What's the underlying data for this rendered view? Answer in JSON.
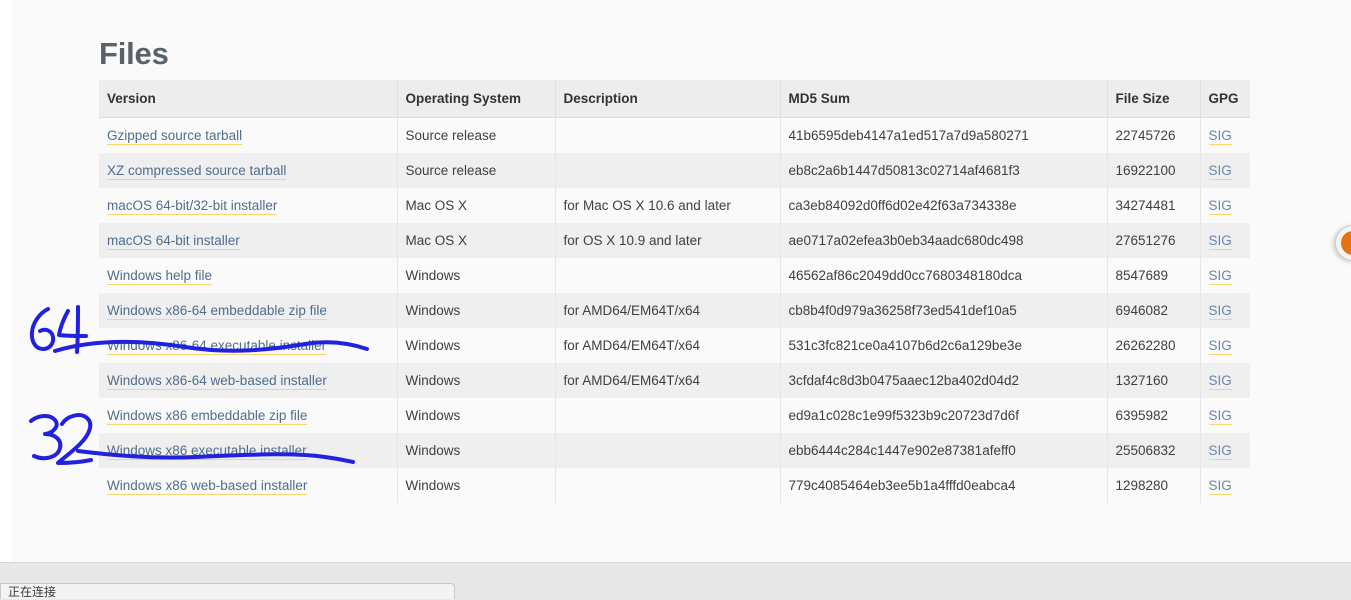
{
  "page": {
    "title": "Files"
  },
  "table": {
    "columns": [
      "Version",
      "Operating System",
      "Description",
      "MD5 Sum",
      "File Size",
      "GPG"
    ],
    "gpg_label": "SIG",
    "rows": [
      {
        "version": "Gzipped source tarball",
        "os": "Source release",
        "description": "",
        "md5": "41b6595deb4147a1ed517a7d9a580271",
        "size": "22745726",
        "gpg": "SIG"
      },
      {
        "version": "XZ compressed source tarball",
        "os": "Source release",
        "description": "",
        "md5": "eb8c2a6b1447d50813c02714af4681f3",
        "size": "16922100",
        "gpg": "SIG"
      },
      {
        "version": "macOS 64-bit/32-bit installer",
        "os": "Mac OS X",
        "description": "for Mac OS X 10.6 and later",
        "md5": "ca3eb84092d0ff6d02e42f63a734338e",
        "size": "34274481",
        "gpg": "SIG"
      },
      {
        "version": "macOS 64-bit installer",
        "os": "Mac OS X",
        "description": "for OS X 10.9 and later",
        "md5": "ae0717a02efea3b0eb34aadc680dc498",
        "size": "27651276",
        "gpg": "SIG"
      },
      {
        "version": "Windows help file",
        "os": "Windows",
        "description": "",
        "md5": "46562af86c2049dd0cc7680348180dca",
        "size": "8547689",
        "gpg": "SIG"
      },
      {
        "version": "Windows x86-64 embeddable zip file",
        "os": "Windows",
        "description": "for AMD64/EM64T/x64",
        "md5": "cb8b4f0d979a36258f73ed541def10a5",
        "size": "6946082",
        "gpg": "SIG"
      },
      {
        "version": "Windows x86-64 executable installer",
        "os": "Windows",
        "description": "for AMD64/EM64T/x64",
        "md5": "531c3fc821ce0a4107b6d2c6a129be3e",
        "size": "26262280",
        "gpg": "SIG"
      },
      {
        "version": "Windows x86-64 web-based installer",
        "os": "Windows",
        "description": "for AMD64/EM64T/x64",
        "md5": "3cfdaf4c8d3b0475aaec12ba402d04d2",
        "size": "1327160",
        "gpg": "SIG"
      },
      {
        "version": "Windows x86 embeddable zip file",
        "os": "Windows",
        "description": "",
        "md5": "ed9a1c028c1e99f5323b9c20723d7d6f",
        "size": "6395982",
        "gpg": "SIG"
      },
      {
        "version": "Windows x86 executable installer",
        "os": "Windows",
        "description": "",
        "md5": "ebb6444c284c1447e902e87381afeff0",
        "size": "25506832",
        "gpg": "SIG"
      },
      {
        "version": "Windows x86 web-based installer",
        "os": "Windows",
        "description": "",
        "md5": "779c4085464eb3ee5b1a4fffd0eabca4",
        "size": "1298280",
        "gpg": "SIG"
      }
    ]
  },
  "annotations": {
    "ink_color": "#2121e0",
    "marks": [
      {
        "name": "handwritten-64",
        "text": "64"
      },
      {
        "name": "handwritten-32",
        "text": "32"
      }
    ]
  },
  "statusbar": {
    "text": "正在连接"
  },
  "colors": {
    "heading": "#5a6169",
    "link": "#4f6d8c",
    "link_underline": "#f5d76e",
    "header_bg": "#ededed",
    "row_odd": "#fafafa",
    "row_even": "#efefef",
    "ink": "#2121e0",
    "fab_orange": "#e8720c"
  }
}
